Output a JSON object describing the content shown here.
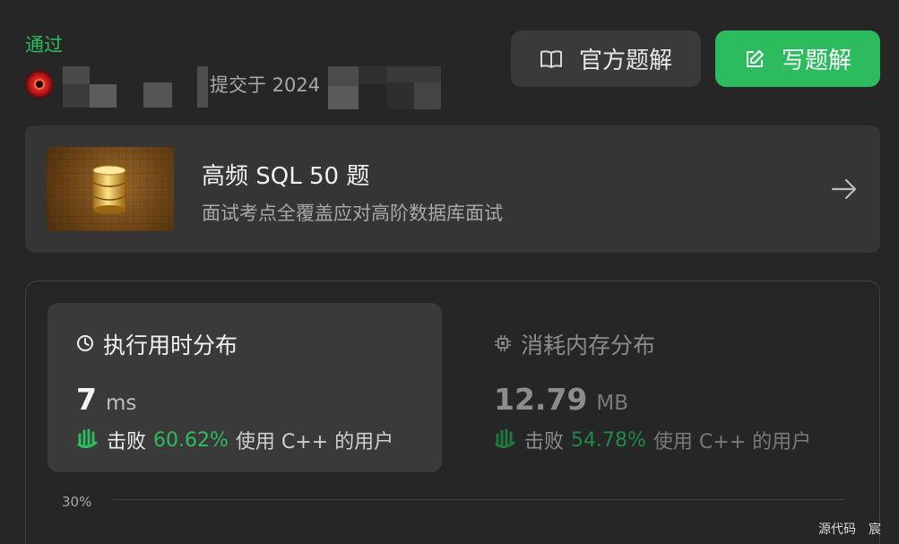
{
  "submission": {
    "status": "通过",
    "submitted_prefix": "提交于 2024"
  },
  "buttons": {
    "official_solution": "官方题解",
    "write_solution": "写题解"
  },
  "study_plan": {
    "title": "高频 SQL 50 题",
    "subtitle": "面试考点全覆盖应对高阶数据库面试"
  },
  "runtime": {
    "title": "执行用时分布",
    "value": "7",
    "unit": "ms",
    "beats_label": "击败",
    "beats_pct": "60.62%",
    "beats_suffix": "使用 C++ 的用户"
  },
  "memory": {
    "title": "消耗内存分布",
    "value": "12.79",
    "unit": "MB",
    "beats_label": "击败",
    "beats_pct": "54.78%",
    "beats_suffix": "使用 C++ 的用户"
  },
  "chart": {
    "y_tick": "30%"
  },
  "footer": "源代码　宸",
  "colors": {
    "accent": "#2cbb5d",
    "background": "#262626",
    "card": "#353535"
  },
  "icons": [
    "book-icon",
    "edit-icon",
    "database-icon",
    "arrow-right-icon",
    "clock-icon",
    "chip-icon",
    "clap-icon"
  ]
}
